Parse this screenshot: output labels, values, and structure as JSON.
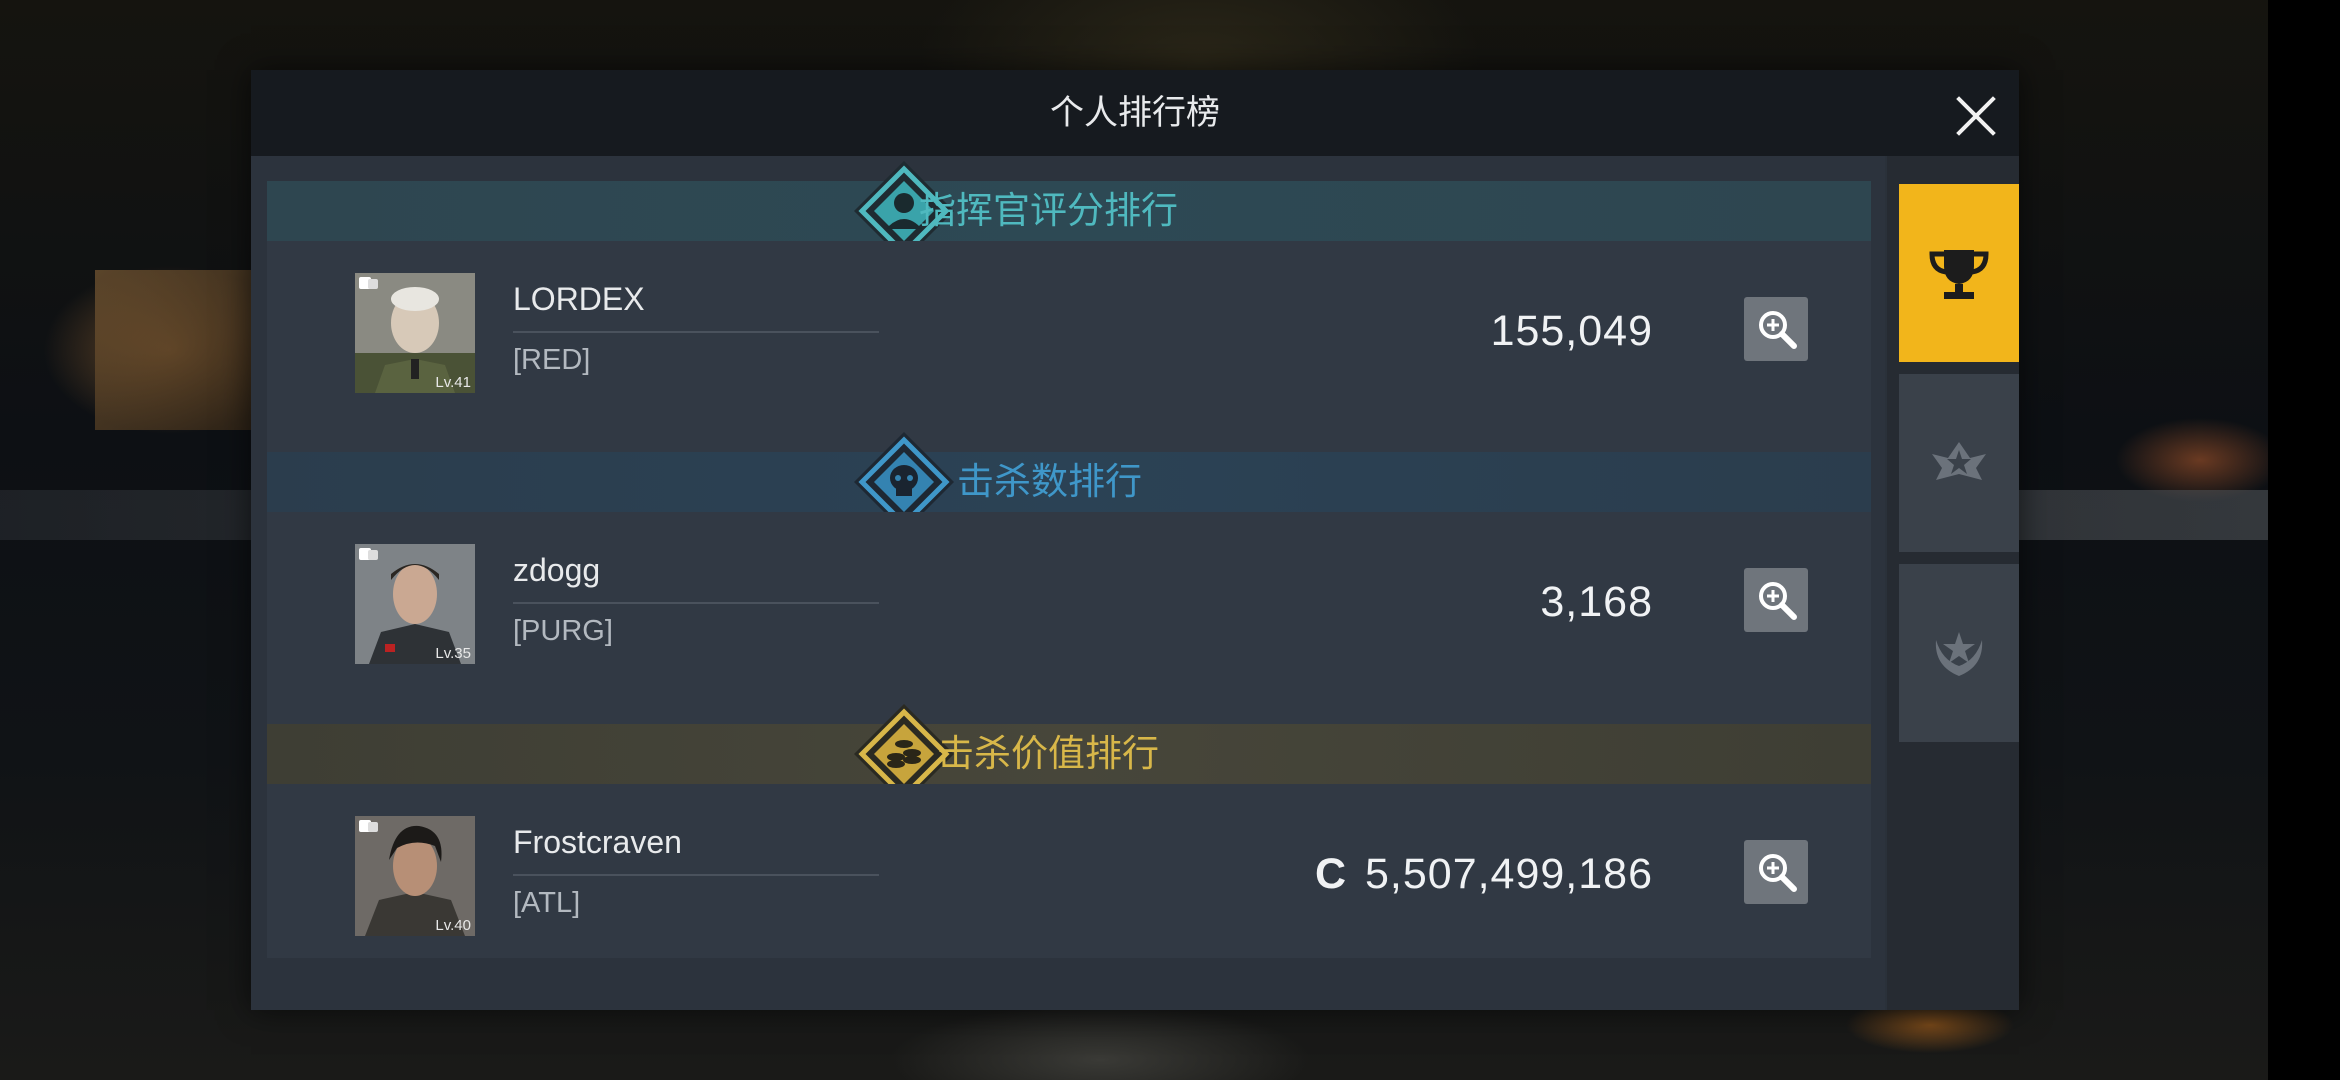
{
  "window": {
    "title": "个人排行榜"
  },
  "sidebar": {
    "tabs": [
      {
        "icon": "trophy-icon",
        "active": true
      },
      {
        "icon": "star-emblem-icon",
        "active": false
      },
      {
        "icon": "laurel-emblem-icon",
        "active": false
      }
    ]
  },
  "sections": [
    {
      "title": "指挥官评分排行",
      "icon": "commander-emblem-icon",
      "color": "#4fb9bf",
      "player": {
        "name": "LORDEX",
        "guild": "[RED]",
        "level": "Lv.41",
        "value": "155,049"
      }
    },
    {
      "title": "击杀数排行",
      "icon": "skull-emblem-icon",
      "color": "#3f97c9",
      "player": {
        "name": "zdogg",
        "guild": "[PURG]",
        "level": "Lv.35",
        "value": "3,168"
      }
    },
    {
      "title": "击杀价值排行",
      "icon": "coins-emblem-icon",
      "color": "#d8b749",
      "player": {
        "name": "Frostcraven",
        "guild": "[ATL]",
        "level": "Lv.40",
        "currency": "C",
        "value": "5,507,499,186"
      }
    }
  ]
}
